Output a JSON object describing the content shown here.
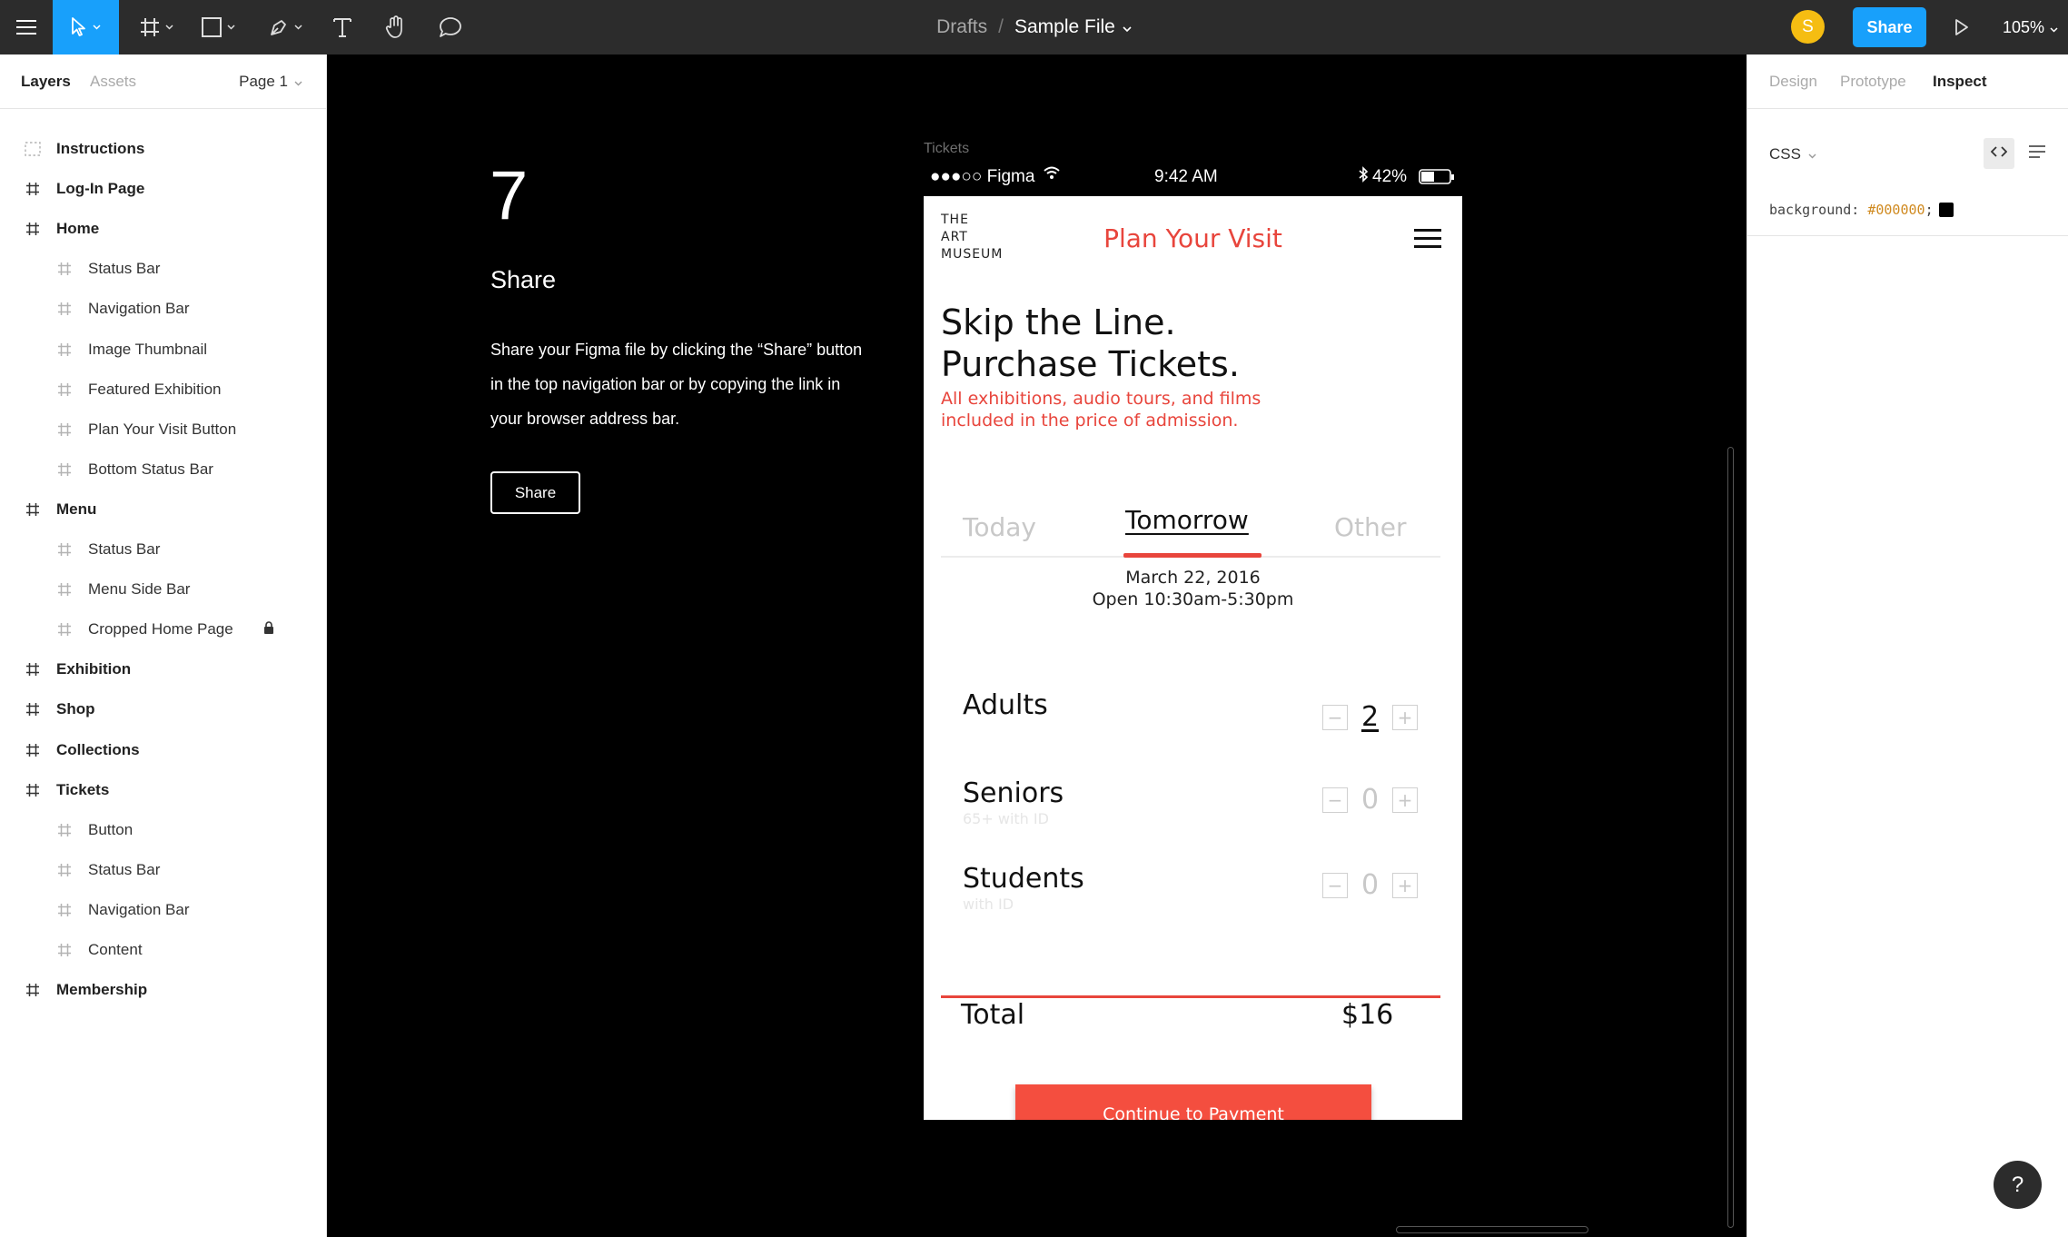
{
  "toolbar": {
    "breadcrumb_root": "Drafts",
    "breadcrumb_sep": "/",
    "file_name": "Sample File",
    "avatar_initial": "S",
    "share_label": "Share",
    "zoom_label": "105%",
    "accent_color": "#18a0fb",
    "tools": [
      "menu-icon",
      "move-tool-icon",
      "frame-tool-icon",
      "shape-tool-icon",
      "pen-tool-icon",
      "text-tool-icon",
      "hand-tool-icon",
      "comment-icon"
    ]
  },
  "left_panel": {
    "tab_layers": "Layers",
    "tab_assets": "Assets",
    "page_select": "Page 1",
    "layers": [
      {
        "label": "Instructions",
        "level": 0,
        "icon": "dashed-frame-icon"
      },
      {
        "label": "Log-In Page",
        "level": 0,
        "icon": "frame-icon"
      },
      {
        "label": "Home",
        "level": 0,
        "icon": "frame-icon"
      },
      {
        "label": "Status Bar",
        "level": 1,
        "icon": "frame-icon"
      },
      {
        "label": "Navigation Bar",
        "level": 1,
        "icon": "frame-icon"
      },
      {
        "label": "Image Thumbnail",
        "level": 1,
        "icon": "frame-icon"
      },
      {
        "label": "Featured Exhibition",
        "level": 1,
        "icon": "frame-icon"
      },
      {
        "label": "Plan Your Visit Button",
        "level": 1,
        "icon": "frame-icon"
      },
      {
        "label": "Bottom Status Bar",
        "level": 1,
        "icon": "frame-icon"
      },
      {
        "label": "Menu",
        "level": 0,
        "icon": "frame-icon"
      },
      {
        "label": "Status Bar",
        "level": 1,
        "icon": "frame-icon"
      },
      {
        "label": "Menu Side Bar",
        "level": 1,
        "icon": "frame-icon"
      },
      {
        "label": "Cropped Home Page",
        "level": 1,
        "icon": "frame-icon",
        "locked": true
      },
      {
        "label": "Exhibition",
        "level": 0,
        "icon": "frame-icon"
      },
      {
        "label": "Shop",
        "level": 0,
        "icon": "frame-icon"
      },
      {
        "label": "Collections",
        "level": 0,
        "icon": "frame-icon"
      },
      {
        "label": "Tickets",
        "level": 0,
        "icon": "frame-icon"
      },
      {
        "label": "Button",
        "level": 1,
        "icon": "frame-icon"
      },
      {
        "label": "Status Bar",
        "level": 1,
        "icon": "frame-icon"
      },
      {
        "label": "Navigation Bar",
        "level": 1,
        "icon": "frame-icon"
      },
      {
        "label": "Content",
        "level": 1,
        "icon": "frame-icon"
      },
      {
        "label": "Membership",
        "level": 0,
        "icon": "frame-icon"
      }
    ]
  },
  "canvas": {
    "step_number": "7",
    "step_title": "Share",
    "step_body": "Share your Figma file by clicking the “Share” button in the top navigation bar or by copying the link in your browser address bar.",
    "step_button": "Share",
    "frame_label": "Tickets",
    "status_bar": {
      "carrier": "●●●○○ Figma",
      "time": "9:42 AM",
      "battery": "42%"
    }
  },
  "phone": {
    "logo": [
      "THE",
      "ART",
      "MUSEUM"
    ],
    "title": "Plan Your Visit",
    "headline": [
      "Skip the Line.",
      "Purchase Tickets."
    ],
    "subhead": [
      "All exhibitions, audio tours, and films",
      "included in the price of admission."
    ],
    "day_tabs": [
      "Today",
      "Tomorrow",
      "Other"
    ],
    "active_tab": "Tomorrow",
    "date": "March 22, 2016",
    "hours": "Open 10:30am-5:30pm",
    "tickets": [
      {
        "name": "Adults",
        "note": "",
        "qty": "2"
      },
      {
        "name": "Seniors",
        "note": "65+ with ID",
        "qty": "0"
      },
      {
        "name": "Students",
        "note": "with ID",
        "qty": "0"
      }
    ],
    "stepper_minus": "−",
    "stepper_plus": "+",
    "total_label": "Total",
    "total_value": "$16",
    "cta": "Continue to Payment",
    "accent_color": "#e8453c"
  },
  "right_panel": {
    "tabs": [
      "Design",
      "Prototype",
      "Inspect"
    ],
    "active_tab": "Inspect",
    "code_lang": "CSS",
    "css_prop": "background:",
    "css_value": "#000000",
    "css_end": ";"
  },
  "help_label": "?"
}
